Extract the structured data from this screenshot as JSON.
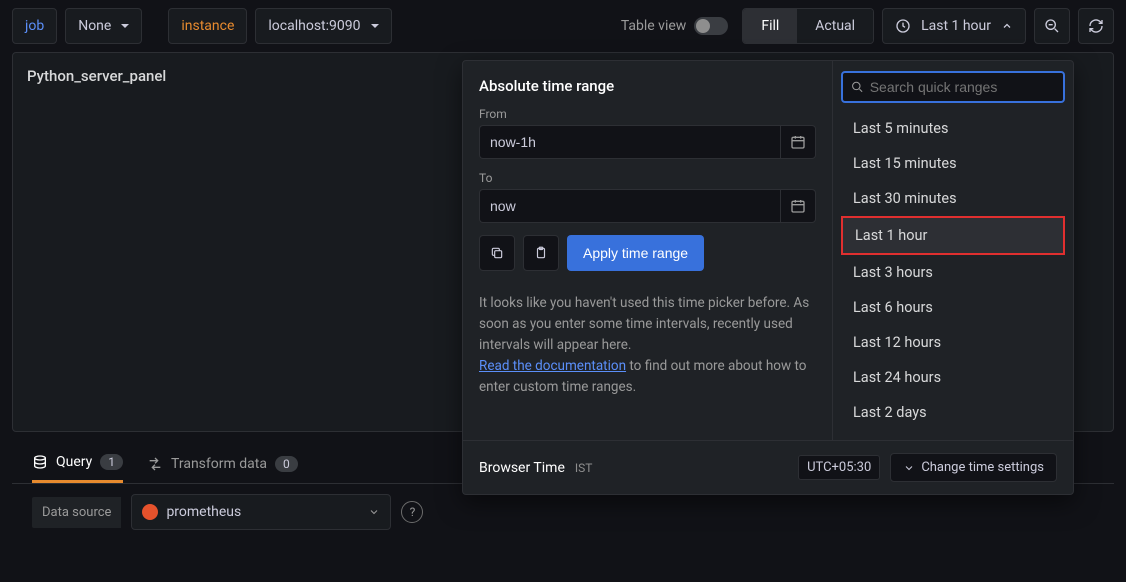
{
  "toolbar": {
    "job_label": "job",
    "job_value": "None",
    "instance_label": "instance",
    "instance_value": "localhost:9090",
    "table_view_label": "Table view",
    "fill_label": "Fill",
    "actual_label": "Actual",
    "time_range_label": "Last 1 hour"
  },
  "panel": {
    "title": "Python_server_panel"
  },
  "tabs": {
    "query_label": "Query",
    "query_count": "1",
    "transform_label": "Transform data",
    "transform_count": "0"
  },
  "datasource": {
    "label": "Data source",
    "value": "prometheus"
  },
  "timepicker": {
    "title": "Absolute time range",
    "from_label": "From",
    "from_value": "now-1h",
    "to_label": "To",
    "to_value": "now",
    "apply_label": "Apply time range",
    "hint_text": "It looks like you haven't used this time picker before. As soon as you enter some time intervals, recently used intervals will appear here.",
    "hint_link": "Read the documentation",
    "hint_tail": " to find out more about how to enter custom time ranges.",
    "search_placeholder": "Search quick ranges",
    "quick_ranges": [
      "Last 5 minutes",
      "Last 15 minutes",
      "Last 30 minutes",
      "Last 1 hour",
      "Last 3 hours",
      "Last 6 hours",
      "Last 12 hours",
      "Last 24 hours",
      "Last 2 days"
    ],
    "selected_index": 3,
    "footer_label": "Browser Time",
    "footer_tz": "IST",
    "utc_offset": "UTC+05:30",
    "change_label": "Change time settings"
  }
}
